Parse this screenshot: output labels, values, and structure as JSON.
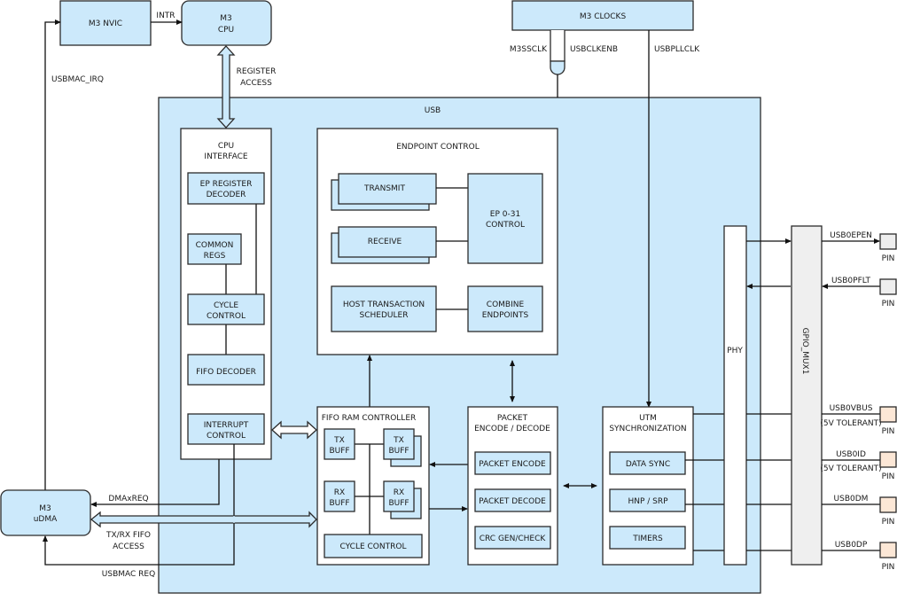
{
  "diagram": {
    "external": {
      "nvic": "M3 NVIC",
      "cpu_line1": "M3",
      "cpu_line2": "CPU",
      "clocks": "M3 CLOCKS",
      "udma_line1": "M3",
      "udma_line2": "uDMA"
    },
    "signals": {
      "intr": "INTR",
      "usbmac_irq": "USBMAC_IRQ",
      "register_access_1": "REGISTER",
      "register_access_2": "ACCESS",
      "m3ssclk": "M3SSCLK",
      "usbclkenb": "USBCLKENB",
      "usbpllclk": "USBPLLCLK",
      "dmaxreq": "DMAxREQ",
      "fifo_access_1": "TX/RX FIFO",
      "fifo_access_2": "ACCESS",
      "usbmac_req": "USBMAC REQ"
    },
    "usb": {
      "title": "USB",
      "cpu_interface": {
        "title_1": "CPU",
        "title_2": "INTERFACE",
        "ep_register_decoder_1": "EP REGISTER",
        "ep_register_decoder_2": "DECODER",
        "common_regs_1": "COMMON",
        "common_regs_2": "REGS",
        "cycle_control_1": "CYCLE",
        "cycle_control_2": "CONTROL",
        "fifo_decoder": "FIFO DECODER",
        "interrupt_control_1": "INTERRUPT",
        "interrupt_control_2": "CONTROL"
      },
      "endpoint_control": {
        "title": "ENDPOINT CONTROL",
        "transmit": "TRANSMIT",
        "receive": "RECEIVE",
        "ep_control_1": "EP 0-31",
        "ep_control_2": "CONTROL",
        "host_sched_1": "HOST TRANSACTION",
        "host_sched_2": "SCHEDULER",
        "combine_1": "COMBINE",
        "combine_2": "ENDPOINTS"
      },
      "fifo_ram": {
        "title": "FIFO RAM CONTROLLER",
        "buff": "BUFF",
        "tx": "TX",
        "rx": "RX",
        "cycle_control": "CYCLE CONTROL"
      },
      "packet": {
        "title_1": "PACKET",
        "title_2": "ENCODE / DECODE",
        "encode": "PACKET ENCODE",
        "decode": "PACKET DECODE",
        "crc": "CRC GEN/CHECK"
      },
      "utm": {
        "title_1": "UTM",
        "title_2": "SYNCHRONIZATION",
        "data_sync": "DATA SYNC",
        "hnp_srp": "HNP / SRP",
        "timers": "TIMERS"
      },
      "phy": "PHY"
    },
    "gpio_mux": "GPIO_MUX1",
    "pins": [
      {
        "signal": "USB0EPEN",
        "note": "",
        "label": "PIN"
      },
      {
        "signal": "USB0PFLT",
        "note": "",
        "label": "PIN"
      },
      {
        "signal": "USB0VBUS",
        "note": "(5V TOLERANT)",
        "label": "PIN"
      },
      {
        "signal": "USB0ID",
        "note": "(5V TOLERANT)",
        "label": "PIN"
      },
      {
        "signal": "USB0DM",
        "note": "",
        "label": "PIN"
      },
      {
        "signal": "USB0DP",
        "note": "",
        "label": "PIN"
      }
    ],
    "colors": {
      "block_fill": "#cce9fb",
      "container_fill": "#ffffff",
      "mux_fill": "#efefef",
      "pin_fill_plain": "#eeeeee",
      "pin_fill_5v": "#fce7d6"
    }
  }
}
